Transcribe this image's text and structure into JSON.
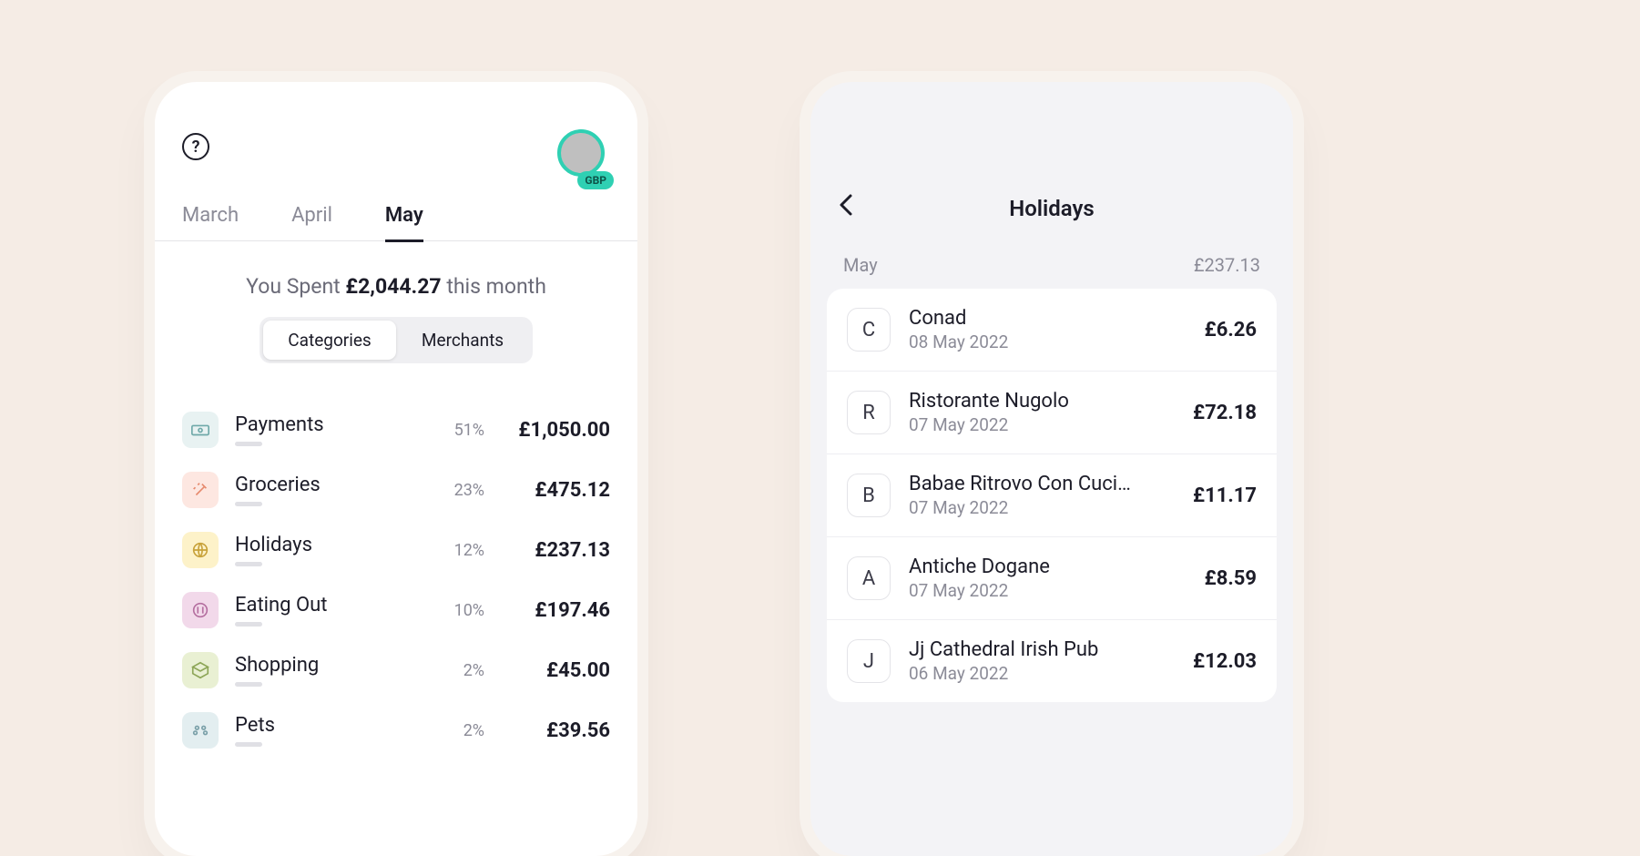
{
  "left": {
    "help_icon_label": "?",
    "currency_badge": "GBP",
    "month_tabs": [
      "March",
      "April",
      "May"
    ],
    "active_tab_index": 2,
    "spent_prefix": "You Spent ",
    "spent_amount": "£2,044.27",
    "spent_suffix": " this month",
    "segments": [
      "Categories",
      "Merchants"
    ],
    "active_segment_index": 0,
    "categories": [
      {
        "icon": "payments",
        "name": "Payments",
        "pct": "51%",
        "amount": "£1,050.00"
      },
      {
        "icon": "groceries",
        "name": "Groceries",
        "pct": "23%",
        "amount": "£475.12"
      },
      {
        "icon": "holidays",
        "name": "Holidays",
        "pct": "12%",
        "amount": "£237.13"
      },
      {
        "icon": "eatingout",
        "name": "Eating Out",
        "pct": "10%",
        "amount": "£197.46"
      },
      {
        "icon": "shopping",
        "name": "Shopping",
        "pct": "2%",
        "amount": "£45.00"
      },
      {
        "icon": "pets",
        "name": "Pets",
        "pct": "2%",
        "amount": "£39.56"
      }
    ]
  },
  "right": {
    "title": "Holidays",
    "summary_month": "May",
    "summary_total": "£237.13",
    "transactions": [
      {
        "letter": "C",
        "name": "Conad",
        "date": "08 May 2022",
        "amount": "£6.26"
      },
      {
        "letter": "R",
        "name": "Ristorante Nugolo",
        "date": "07 May 2022",
        "amount": "£72.18"
      },
      {
        "letter": "B",
        "name": "Babae Ritrovo Con Cuci…",
        "date": "07 May 2022",
        "amount": "£11.17"
      },
      {
        "letter": "A",
        "name": "Antiche Dogane",
        "date": "07 May 2022",
        "amount": "£8.59"
      },
      {
        "letter": "J",
        "name": "Jj Cathedral Irish Pub",
        "date": "06 May 2022",
        "amount": "£12.03"
      }
    ]
  }
}
